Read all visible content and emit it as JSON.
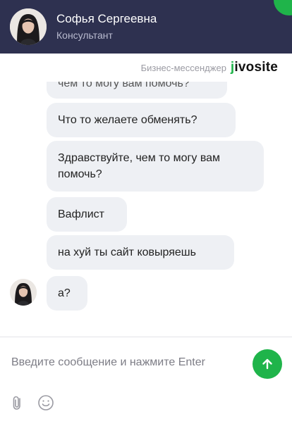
{
  "header": {
    "agent_name": "Софья Сергеевна",
    "agent_role": "Консультант"
  },
  "brand": {
    "tagline": "Бизнес-мессенджер",
    "logo_j": "j",
    "logo_rest": "ivosite"
  },
  "messages": [
    {
      "text": "чем то могу вам помочь?",
      "partial": true
    },
    {
      "text": "Что то желаете обменять?"
    },
    {
      "text": "Здравствуйте, чем то могу вам помочь?"
    },
    {
      "text": "Вафлист"
    },
    {
      "text": "на хуй ты сайт ковыряешь"
    },
    {
      "text": "а?"
    }
  ],
  "composer": {
    "placeholder": "Введите сообщение и нажмите Enter"
  },
  "icons": {
    "send": "arrow-up-icon",
    "attach": "paperclip-icon",
    "emoji": "smiley-icon"
  },
  "colors": {
    "header_bg": "#2e3150",
    "accent": "#1fb44a",
    "bubble_bg": "#eef0f4"
  }
}
